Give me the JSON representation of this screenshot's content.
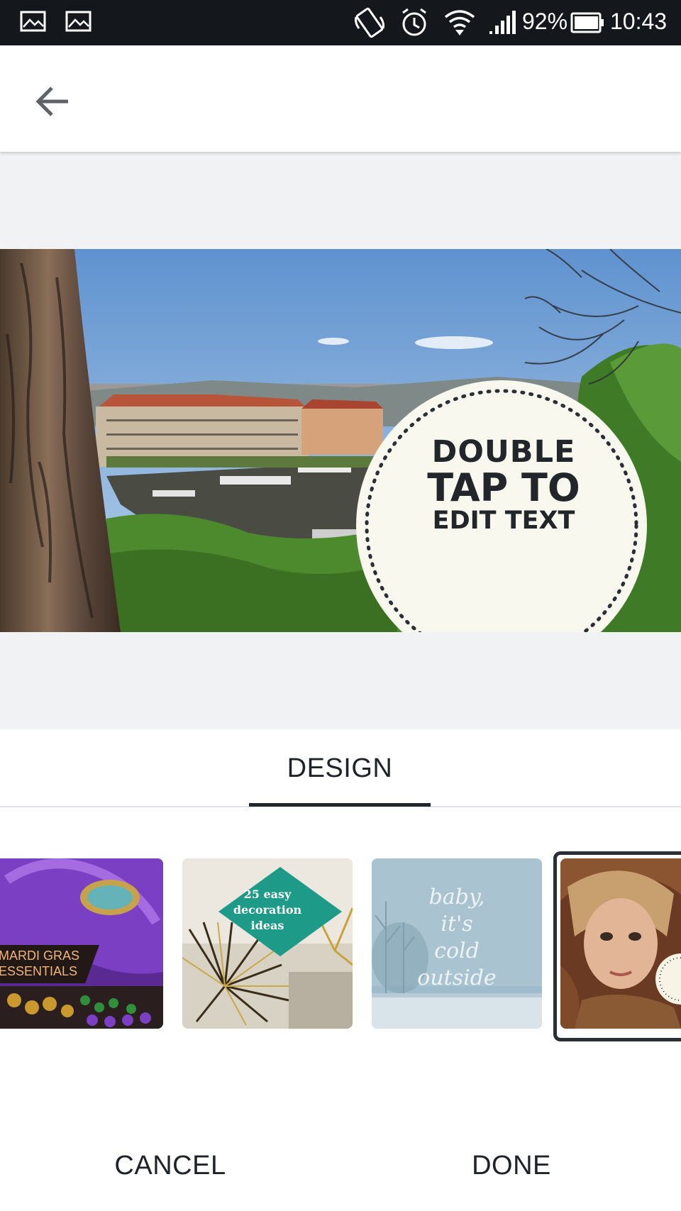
{
  "status_bar": {
    "battery": "92%",
    "time": "10:43"
  },
  "design": {
    "badge_line1": "DOUBLE",
    "badge_line2": "TAP TO",
    "badge_line3": "EDIT TEXT"
  },
  "tabs": {
    "design_label": "DESIGN"
  },
  "thumbnails": {
    "mardi_line1": "MARDI GRAS",
    "mardi_line2": "ESSENTIALS",
    "deco_line1": "25 easy",
    "deco_line2": "decoration",
    "deco_line3": "ideas",
    "cold_line1": "baby,",
    "cold_line2": "it's",
    "cold_line3": "cold",
    "cold_line4": "outside"
  },
  "actions": {
    "cancel_label": "CANCEL",
    "done_label": "DONE"
  }
}
